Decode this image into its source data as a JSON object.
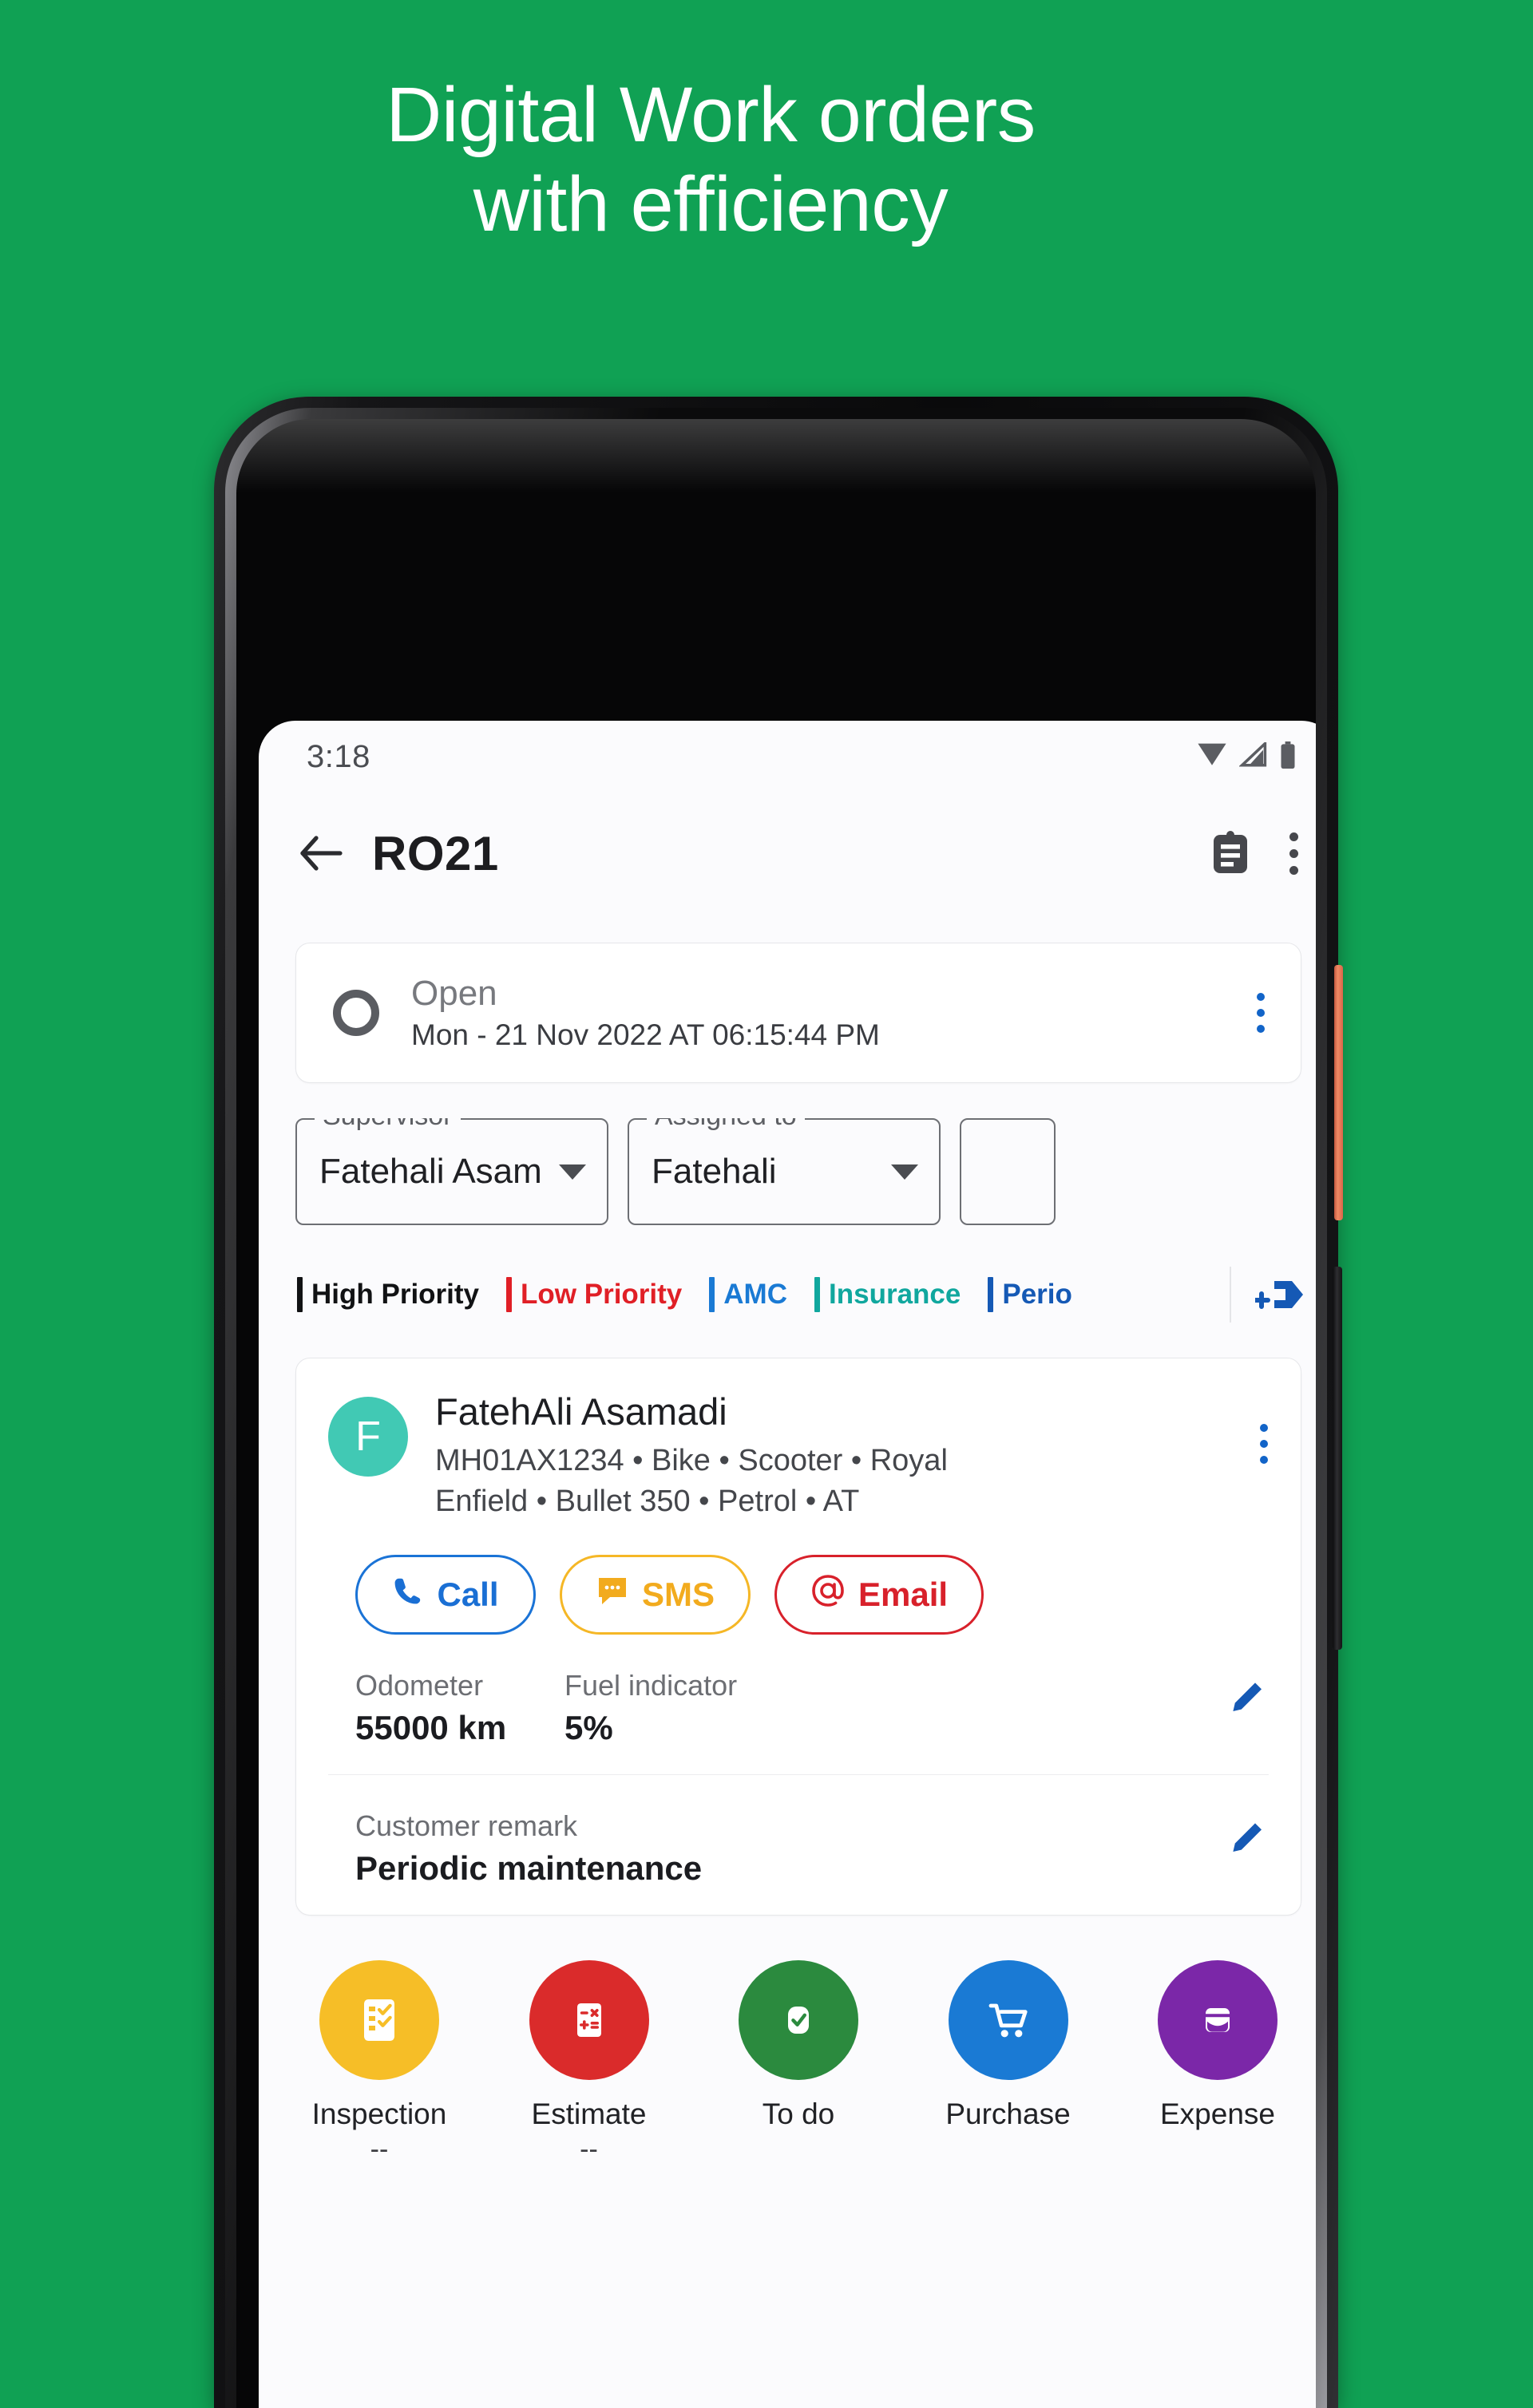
{
  "promo": {
    "headline": "Digital Work orders\nwith efficiency",
    "background_color": "#10A154",
    "text_color": "#FFFFFF"
  },
  "status_bar": {
    "time": "3:18",
    "icons": [
      "wifi-icon",
      "signal-icon",
      "battery-icon"
    ]
  },
  "app_bar": {
    "back_label": "back-arrow-icon",
    "title": "RO21",
    "clipboard_label": "clipboard-icon",
    "overflow_label": "more-vertical-icon"
  },
  "status_card": {
    "state": "Open",
    "datetime": "Mon - 21 Nov 2022 AT 06:15:44 PM",
    "menu_label": "more-vertical-icon"
  },
  "fields": [
    {
      "legend": "Supervisor",
      "value": "Fatehali Asam"
    },
    {
      "legend": "Assigned to",
      "value": "Fatehali"
    },
    {
      "legend": "",
      "value": ""
    }
  ],
  "tags": [
    {
      "label": "High Priority",
      "color": "#111214"
    },
    {
      "label": "Low Priority",
      "color": "#e01f26"
    },
    {
      "label": "AMC",
      "color": "#1a7ad4"
    },
    {
      "label": "Insurance",
      "color": "#10a79e"
    },
    {
      "label": "Perio",
      "color": "#1559b5"
    }
  ],
  "add_tag_label": "add-tag-icon",
  "customer": {
    "avatar_initial": "F",
    "avatar_color": "#41C9B4",
    "name": "FatehAli Asamadi",
    "vehicle": "MH01AX1234 • Bike • Scooter • Royal Enfield • Bullet 350 • Petrol • AT",
    "menu_label": "more-vertical-icon",
    "contact_buttons": [
      {
        "label": "Call",
        "icon": "phone-icon",
        "color": "#1A6FD4"
      },
      {
        "label": "SMS",
        "icon": "message-icon",
        "color": "#F2AB1E"
      },
      {
        "label": "Email",
        "icon": "at-sign-icon",
        "color": "#D8212B"
      }
    ],
    "details": [
      {
        "label": "Odometer",
        "value": "55000 km"
      },
      {
        "label": "Fuel indicator",
        "value": "5%"
      }
    ],
    "remark_label": "Customer remark",
    "remark_value": "Periodic maintenance",
    "edit_label": "edit-pencil-icon"
  },
  "actions": [
    {
      "label": "Inspection",
      "sub": "--",
      "icon": "checklist-icon",
      "color": "#F6BE27"
    },
    {
      "label": "Estimate",
      "sub": "--",
      "icon": "calculator-icon",
      "color": "#DA2B2B"
    },
    {
      "label": "To do",
      "sub": "",
      "icon": "check-circle-icon",
      "color": "#2B8A3E"
    },
    {
      "label": "Purchase",
      "sub": "",
      "icon": "cart-icon",
      "color": "#1A7AD4"
    },
    {
      "label": "Expense",
      "sub": "",
      "icon": "wallet-icon",
      "color": "#7B27A8"
    }
  ]
}
